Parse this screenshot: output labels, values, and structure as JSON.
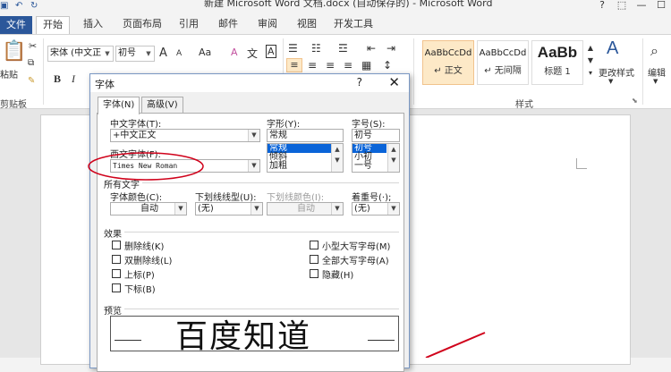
{
  "window": {
    "title": "新建 Microsoft Word 文档.docx (自动保存的) - Microsoft Word",
    "controls": [
      "?",
      "⬚",
      "—",
      "☐"
    ]
  },
  "tabs": [
    {
      "label": "文件"
    },
    {
      "label": "开始"
    },
    {
      "label": "插入"
    },
    {
      "label": "页面布局"
    },
    {
      "label": "引用"
    },
    {
      "label": "邮件"
    },
    {
      "label": "审阅"
    },
    {
      "label": "视图"
    },
    {
      "label": "开发工具"
    }
  ],
  "ribbon": {
    "clipboard": {
      "paste_label": "粘贴",
      "group_label": "剪贴板"
    },
    "font": {
      "name": "宋体 (中文正",
      "size": "初号",
      "bold": "B",
      "italic": "I",
      "grow": "A",
      "shrink": "A",
      "case": "Aa",
      "clear": "A",
      "phonetic": "文",
      "border": "A"
    },
    "styles": {
      "group_label": "样式",
      "items": [
        {
          "sample": "AaBbCcDd",
          "name": "↵ 正文"
        },
        {
          "sample": "AaBbCcDd",
          "name": "↵ 无间隔"
        },
        {
          "sample": "AaBb",
          "name": "标题 1"
        }
      ],
      "change_styles": "更改样式",
      "edit": "编辑"
    }
  },
  "dialog": {
    "title": "字体",
    "help": "?",
    "close": "✕",
    "tabs": [
      {
        "label": "字体(N)"
      },
      {
        "label": "高级(V)"
      }
    ],
    "chinese_font_label": "中文字体(T):",
    "chinese_font_value": "+中文正文",
    "western_font_label": "西文字体(F):",
    "western_font_value": "Times New Roman",
    "style_label": "字形(Y):",
    "style_value": "常规",
    "style_list": [
      "常规",
      "倾斜",
      "加粗"
    ],
    "size_label": "字号(S):",
    "size_value": "初号",
    "size_list": [
      "初号",
      "小初",
      "一号"
    ],
    "all_text_label": "所有文字",
    "color_label": "字体颜色(C):",
    "color_value": "自动",
    "underline_type_label": "下划线线型(U):",
    "underline_type_value": "(无)",
    "underline_color_label": "下划线颜色(I):",
    "underline_color_value": "自动",
    "emphasis_label": "着重号(·);",
    "emphasis_value": "(无)",
    "effects_label": "效果",
    "effects_left": [
      "删除线(K)",
      "双删除线(L)",
      "上标(P)",
      "下标(B)"
    ],
    "effects_right": [
      "小型大写字母(M)",
      "全部大写字母(A)",
      "隐藏(H)"
    ],
    "preview_label": "预览",
    "preview_text": "百度知道"
  },
  "colors": {
    "accent": "#2b579a",
    "annotation": "#d0021b",
    "selection": "#0a64d8"
  }
}
